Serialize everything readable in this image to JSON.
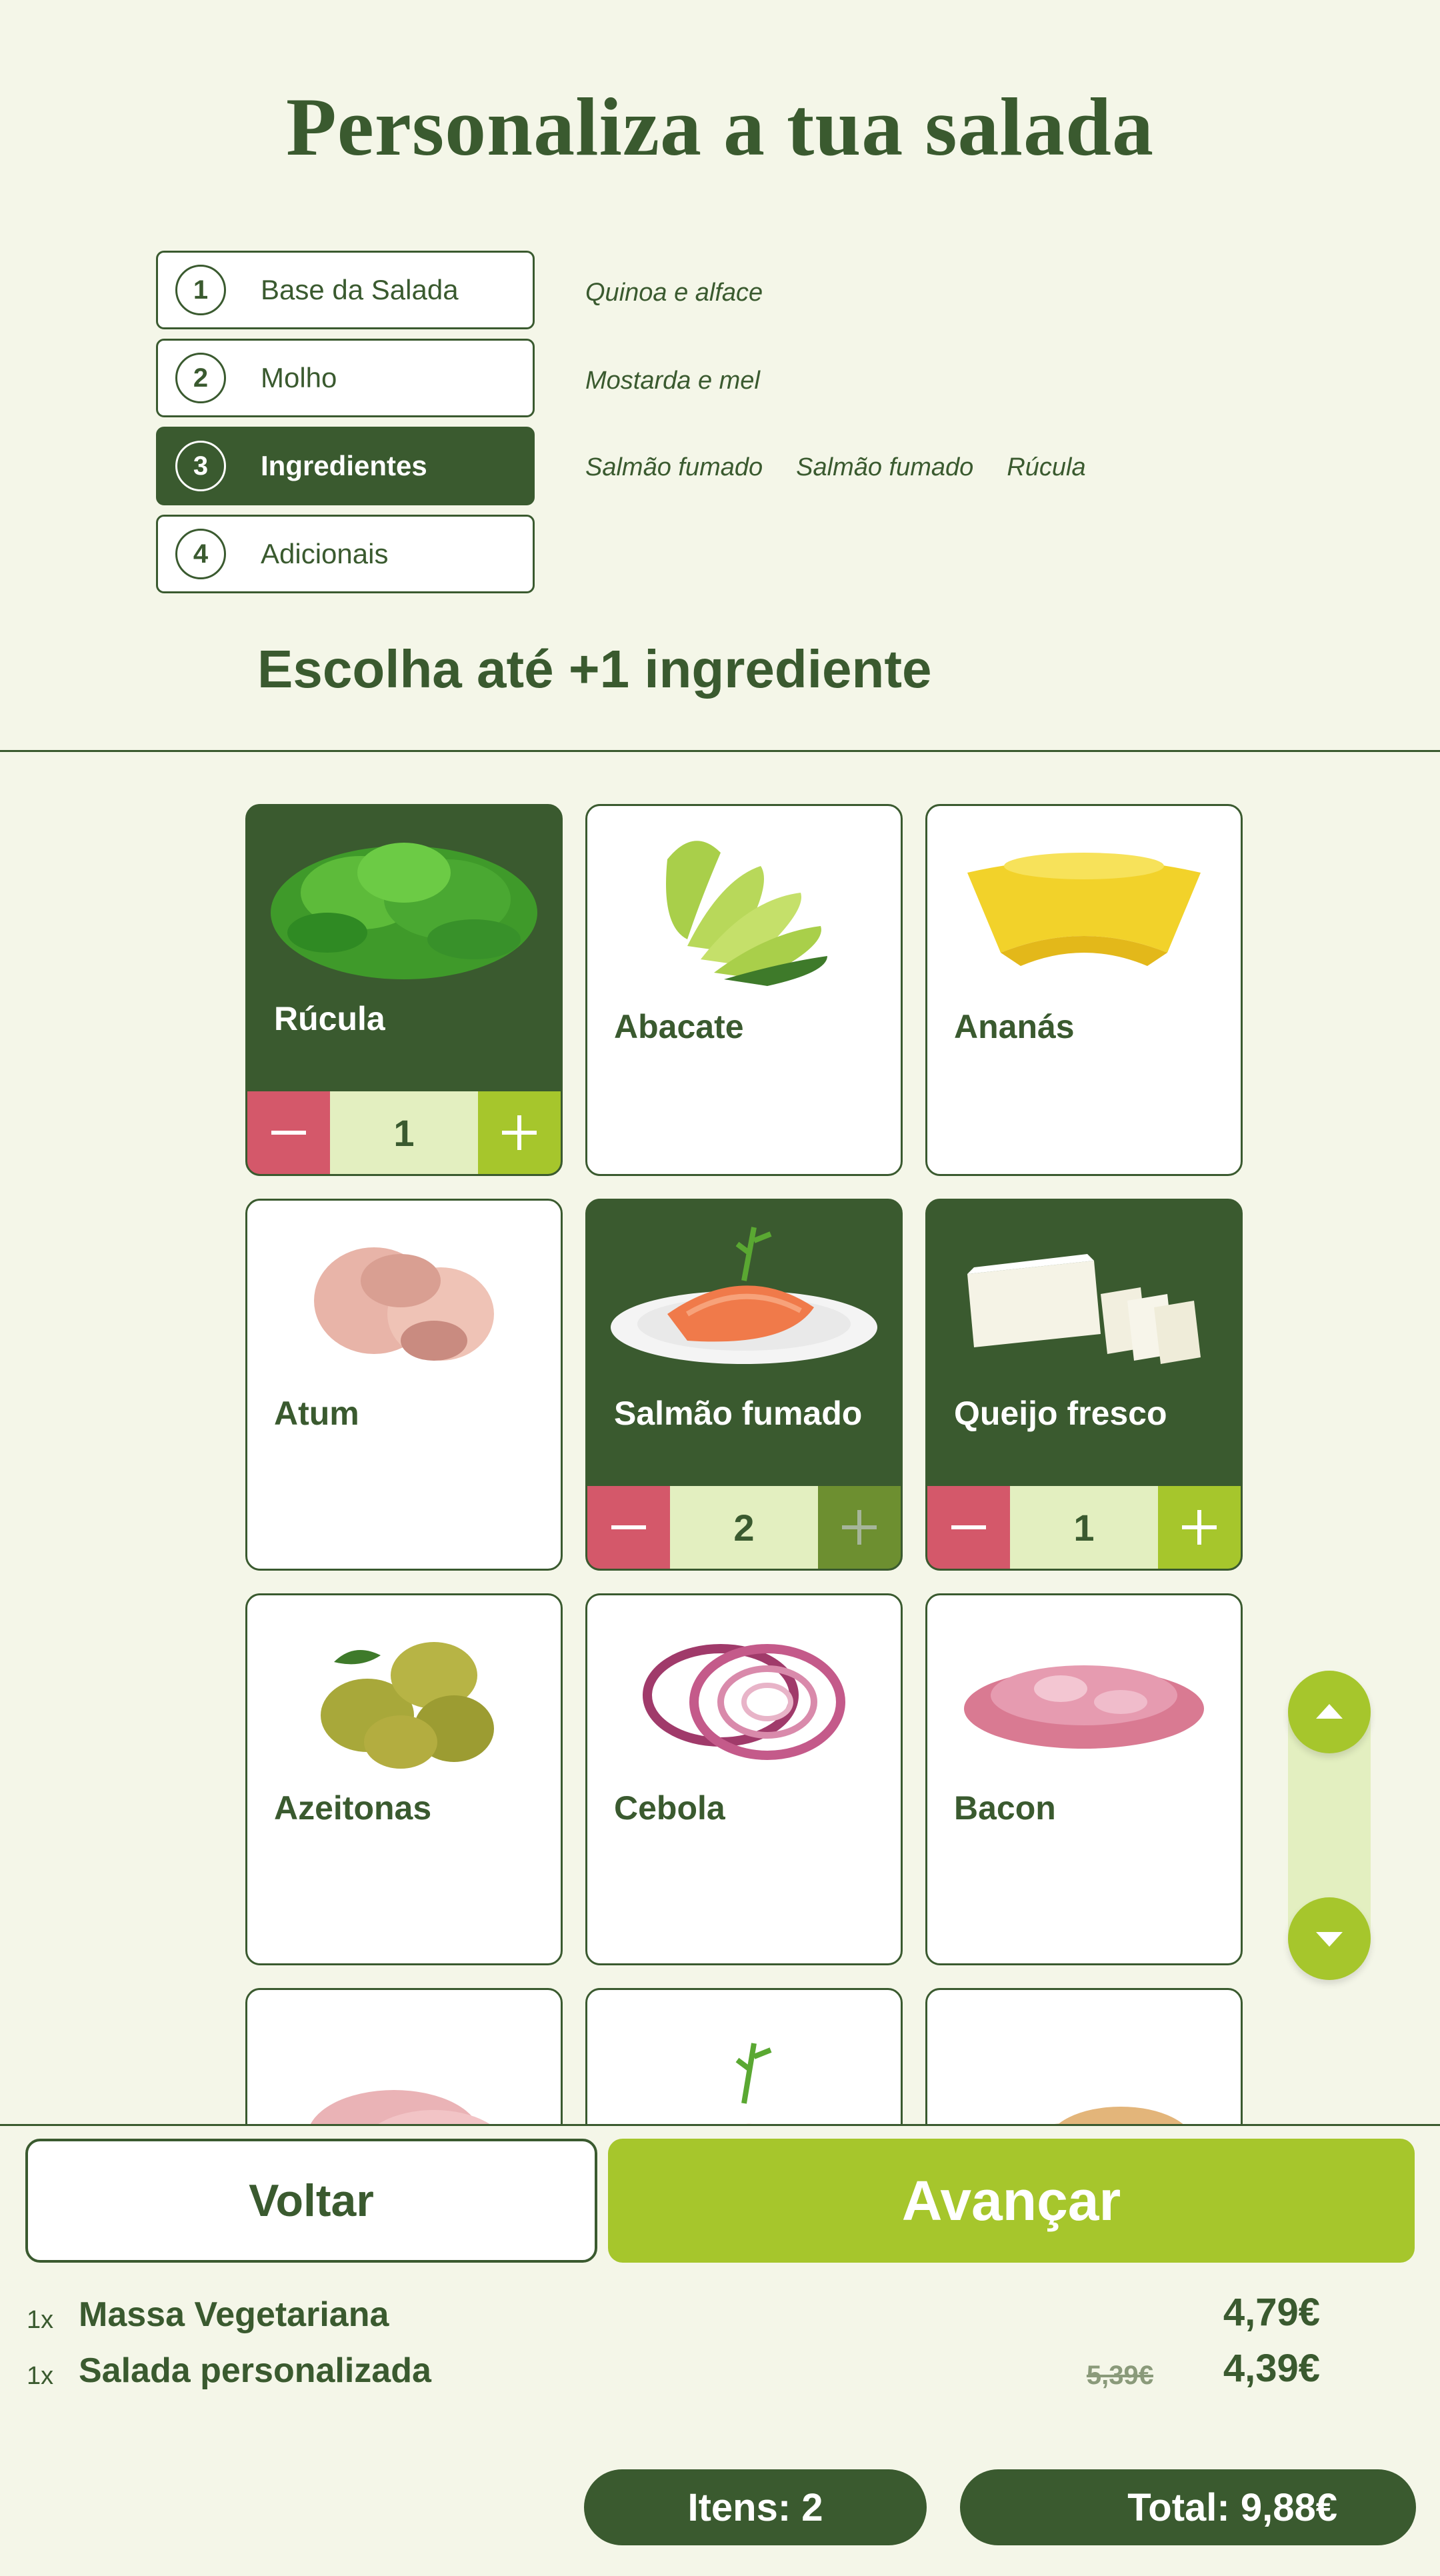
{
  "header": {
    "title": "Personaliza a tua salada"
  },
  "steps": [
    {
      "number": "1",
      "label": "Base da Salada",
      "summary": [
        "Quinoa e alface"
      ]
    },
    {
      "number": "2",
      "label": "Molho",
      "summary": [
        "Mostarda e mel"
      ]
    },
    {
      "number": "3",
      "label": "Ingredientes",
      "summary": [
        "Salmão fumado",
        "Salmão fumado",
        "Rúcula"
      ],
      "active": true
    },
    {
      "number": "4",
      "label": "Adicionais",
      "summary": []
    }
  ],
  "instruction": "Escolha até +1 ingrediente",
  "ingredients": [
    {
      "name": "Rúcula",
      "selected": true,
      "quantity": "1",
      "icon": "arugula-image"
    },
    {
      "name": "Abacate",
      "selected": false,
      "icon": "avocado-image"
    },
    {
      "name": "Ananás",
      "selected": false,
      "icon": "pineapple-image"
    },
    {
      "name": "Atum",
      "selected": false,
      "icon": "tuna-image"
    },
    {
      "name": "Salmão fumado",
      "selected": true,
      "quantity": "2",
      "icon": "salmon-image",
      "plus_disabled": true
    },
    {
      "name": "Queijo fresco",
      "selected": true,
      "quantity": "1",
      "icon": "fresh-cheese-image"
    },
    {
      "name": "Azeitonas",
      "selected": false,
      "icon": "olives-image"
    },
    {
      "name": "Cebola",
      "selected": false,
      "icon": "onion-image"
    },
    {
      "name": "Bacon",
      "selected": false,
      "icon": "bacon-image"
    },
    {
      "name": "",
      "selected": false,
      "icon": "ham-image"
    },
    {
      "name": "",
      "selected": false,
      "icon": "salmon-image"
    },
    {
      "name": "",
      "selected": false,
      "icon": "chicken-image"
    }
  ],
  "actions": {
    "back": "Voltar",
    "next": "Avançar"
  },
  "order": [
    {
      "qty": "1x",
      "name": "Massa Vegetariana",
      "price": "4,79€"
    },
    {
      "qty": "1x",
      "name": "Salada personalizada",
      "old_price": "5,39€",
      "price": "4,39€"
    }
  ],
  "footer": {
    "items": "Itens: 2",
    "total": "Total: 9,88€"
  },
  "colors": {
    "primary": "#3a5a2f",
    "accent": "#a6c62c",
    "minus": "#d4586a",
    "qty_bg": "#e3efc0",
    "background": "#f4f6e8"
  }
}
